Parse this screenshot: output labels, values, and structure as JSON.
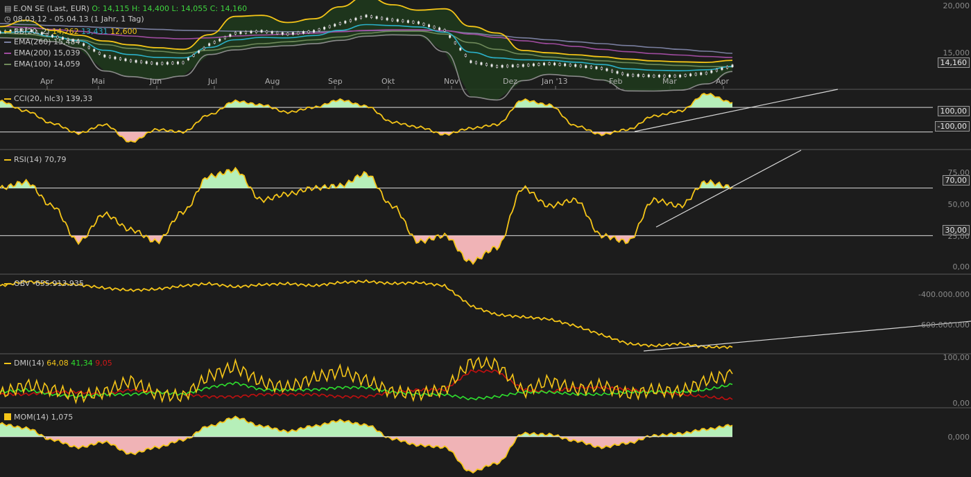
{
  "header": {
    "title": "E.ON SE (Last, EUR)",
    "ohlc": {
      "o": "O: 14,115",
      "h": "H: 14,400",
      "l": "L: 14,055",
      "c": "C: 14,160"
    },
    "range": "08.03.12 - 05.04.13 (1 Jahr, 1 Tag)",
    "icons": {
      "title": "chart-icon",
      "range": "clock-icon"
    }
  },
  "colors": {
    "background": "#1c1c1c",
    "price_yellow": "#f5c518",
    "bb_fill": "#1f3a1c",
    "ema260": "#7a7fa0",
    "ema200": "#a04ca0",
    "ema100": "#6f8a5a",
    "middle_band": "#2bb0c8",
    "positive_fill": "#b6efb9",
    "negative_fill": "#f0b3b6",
    "dmi_plus": "#2ee02e",
    "dmi_minus": "#c01010",
    "ohlc_green": "#3fd43f"
  },
  "legend": {
    "bb": {
      "label": "BB(20, 2)",
      "v1": "14,262",
      "v2": "13,431",
      "v3": "12,600"
    },
    "ema260": {
      "label": "EMA(260)",
      "value": "15,484"
    },
    "ema200": {
      "label": "EMA(200)",
      "value": "15,039"
    },
    "ema100": {
      "label": "EMA(100)",
      "value": "14,059"
    }
  },
  "price_axis": {
    "ticks": [
      "20,000",
      "15,000"
    ],
    "last_tag": "14,160"
  },
  "x_axis": {
    "labels": [
      "Apr",
      "Mai",
      "Jun",
      "Jul",
      "Aug",
      "Sep",
      "Okt",
      "Nov",
      "Dez",
      "Jan '13",
      "Feb",
      "Mar",
      "Apr"
    ]
  },
  "panels": {
    "cci": {
      "label": "CCI(20, hlc3)",
      "value": "139,33",
      "tags": [
        "100,00",
        "-100,00"
      ]
    },
    "rsi": {
      "label": "RSI(14)",
      "value": "70,79",
      "ticks": [
        "75,00",
        "50,00",
        "25,00",
        "0,00"
      ],
      "tags": [
        "70,00",
        "30,00"
      ]
    },
    "obv": {
      "label": "OBV",
      "value": "-655.913.935",
      "ticks": [
        "-400.000.000",
        "-600.000.000"
      ]
    },
    "dmi": {
      "label": "DMI(14)",
      "adx": "64,08",
      "plus": "41,34",
      "minus": "9,05",
      "ticks": [
        "100,00",
        "0,00"
      ]
    },
    "mom": {
      "label": "MOM(14)",
      "value": "1,075",
      "ticks": [
        "0,000"
      ]
    }
  },
  "chart_data": [
    {
      "type": "line",
      "title": "E.ON SE (Last, EUR)",
      "x": [
        "2012-03-08",
        "2012-03-23",
        "2012-04-06",
        "2012-04-20",
        "2012-05-04",
        "2012-05-18",
        "2012-06-01",
        "2012-06-15",
        "2012-06-29",
        "2012-07-13",
        "2012-07-27",
        "2012-08-10",
        "2012-08-24",
        "2012-09-07",
        "2012-09-21",
        "2012-10-05",
        "2012-10-19",
        "2012-11-02",
        "2012-11-16",
        "2012-11-30",
        "2012-12-14",
        "2012-12-28",
        "2013-01-11",
        "2013-01-25",
        "2013-02-08",
        "2013-02-22",
        "2013-03-08",
        "2013-03-22",
        "2013-04-05"
      ],
      "series": [
        {
          "name": "E.ON SE (Last, EUR)",
          "values": [
            17.7,
            18.0,
            17.3,
            16.7,
            15.2,
            14.7,
            14.4,
            14.5,
            16.4,
            17.6,
            17.8,
            17.5,
            17.8,
            18.6,
            19.4,
            19.0,
            18.7,
            17.9,
            14.6,
            14.1,
            14.2,
            14.4,
            14.2,
            13.9,
            13.2,
            13.1,
            13.1,
            13.4,
            14.16
          ]
        },
        {
          "name": "EMA(260)",
          "values": [
            18.6,
            18.5,
            18.4,
            18.3,
            18.2,
            18.1,
            18.0,
            17.9,
            17.85,
            17.8,
            17.78,
            17.75,
            17.75,
            17.8,
            17.85,
            17.88,
            17.9,
            17.85,
            17.6,
            17.35,
            17.1,
            16.9,
            16.7,
            16.5,
            16.3,
            16.1,
            15.9,
            15.7,
            15.484
          ]
        },
        {
          "name": "EMA(200)",
          "values": [
            18.3,
            18.2,
            18.0,
            17.8,
            17.5,
            17.3,
            17.1,
            17.0,
            17.1,
            17.3,
            17.4,
            17.5,
            17.6,
            17.75,
            17.9,
            17.95,
            17.95,
            17.85,
            17.5,
            17.15,
            16.8,
            16.5,
            16.2,
            15.9,
            15.65,
            15.45,
            15.3,
            15.15,
            15.039
          ]
        },
        {
          "name": "EMA(100)",
          "values": [
            17.6,
            17.5,
            17.2,
            16.9,
            16.4,
            16.0,
            15.7,
            15.5,
            15.8,
            16.2,
            16.5,
            16.7,
            16.9,
            17.2,
            17.6,
            17.8,
            17.8,
            17.5,
            16.6,
            15.9,
            15.4,
            15.1,
            14.9,
            14.7,
            14.5,
            14.3,
            14.2,
            14.1,
            14.059
          ]
        }
      ],
      "bollinger": {
        "upper_last": 14.262,
        "middle_last": 13.431,
        "lower_last": 12.6
      },
      "ylabel": "",
      "ylim": [
        12.5,
        20.5
      ],
      "y_ticks": [
        15,
        20
      ],
      "grid": false,
      "legend": "top-left"
    },
    {
      "type": "area",
      "title": "CCI(20, hlc3)",
      "x_count": 29,
      "values": [
        150,
        70,
        -30,
        -110,
        -40,
        -180,
        -80,
        -100,
        40,
        150,
        120,
        60,
        100,
        160,
        110,
        -20,
        -60,
        -120,
        -70,
        -40,
        160,
        120,
        -50,
        -120,
        -80,
        30,
        70,
        210,
        139.33
      ],
      "reference_lines": [
        100,
        -100
      ],
      "last": 139.33
    },
    {
      "type": "area",
      "title": "RSI(14)",
      "x_count": 29,
      "values": [
        70,
        75,
        55,
        25,
        48,
        35,
        25,
        50,
        80,
        85,
        60,
        65,
        70,
        72,
        82,
        55,
        25,
        30,
        8,
        20,
        70,
        55,
        60,
        30,
        25,
        60,
        55,
        75,
        70.79
      ],
      "reference_lines": [
        70,
        30
      ],
      "ylim": [
        0,
        100
      ],
      "y_ticks": [
        0,
        25,
        50,
        75
      ],
      "last": 70.79
    },
    {
      "type": "line",
      "title": "OBV",
      "x_count": 29,
      "values": [
        -380,
        -360,
        -370,
        -375,
        -390,
        -400,
        -395,
        -380,
        -370,
        -385,
        -375,
        -370,
        -380,
        -365,
        -360,
        -370,
        -365,
        -380,
        -470,
        -510,
        -520,
        -530,
        -560,
        -600,
        -640,
        -650,
        -640,
        -655,
        -655.9
      ],
      "value_unit": "millions",
      "y_ticks": [
        -400000000,
        -600000000
      ],
      "last": -655913935
    },
    {
      "type": "line",
      "title": "DMI(14)",
      "x_count": 29,
      "series": [
        {
          "name": "ADX",
          "values": [
            20,
            40,
            30,
            15,
            25,
            50,
            20,
            15,
            60,
            80,
            45,
            35,
            55,
            70,
            50,
            25,
            20,
            30,
            90,
            85,
            25,
            50,
            30,
            40,
            20,
            30,
            25,
            50,
            64.08
          ]
        },
        {
          "name": "+DI",
          "values": [
            25,
            30,
            20,
            15,
            20,
            20,
            25,
            20,
            35,
            45,
            30,
            30,
            30,
            35,
            35,
            25,
            20,
            20,
            10,
            15,
            25,
            25,
            20,
            20,
            25,
            25,
            25,
            30,
            41.34
          ]
        },
        {
          "name": "-DI",
          "values": [
            20,
            20,
            25,
            25,
            20,
            30,
            25,
            20,
            15,
            15,
            20,
            20,
            20,
            15,
            15,
            25,
            30,
            30,
            70,
            70,
            30,
            25,
            35,
            35,
            30,
            25,
            20,
            15,
            9.05
          ]
        }
      ],
      "ylim": [
        0,
        100
      ],
      "y_ticks": [
        0,
        100
      ]
    },
    {
      "type": "area",
      "title": "MOM(14)",
      "x_count": 29,
      "values": [
        1.2,
        0.8,
        -0.3,
        -1.0,
        -0.5,
        -1.6,
        -1.0,
        -0.3,
        1.0,
        1.8,
        1.0,
        0.5,
        1.0,
        1.5,
        1.1,
        -0.2,
        -0.8,
        -1.0,
        -3.3,
        -2.5,
        0.3,
        0.2,
        -0.4,
        -1.0,
        -0.6,
        0.1,
        0.3,
        0.7,
        1.075
      ],
      "reference_lines": [
        0
      ],
      "last": 1.075
    }
  ]
}
